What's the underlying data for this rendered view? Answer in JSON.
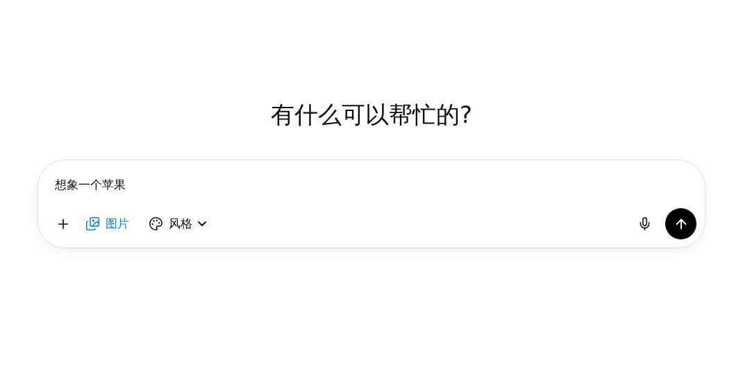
{
  "heading": "有什么可以帮忙的?",
  "composer": {
    "value": "想象一个苹果",
    "tools": [
      {
        "kind": "image",
        "label": "图片",
        "selected": true
      },
      {
        "kind": "style",
        "label": "风格",
        "selected": false
      }
    ]
  }
}
